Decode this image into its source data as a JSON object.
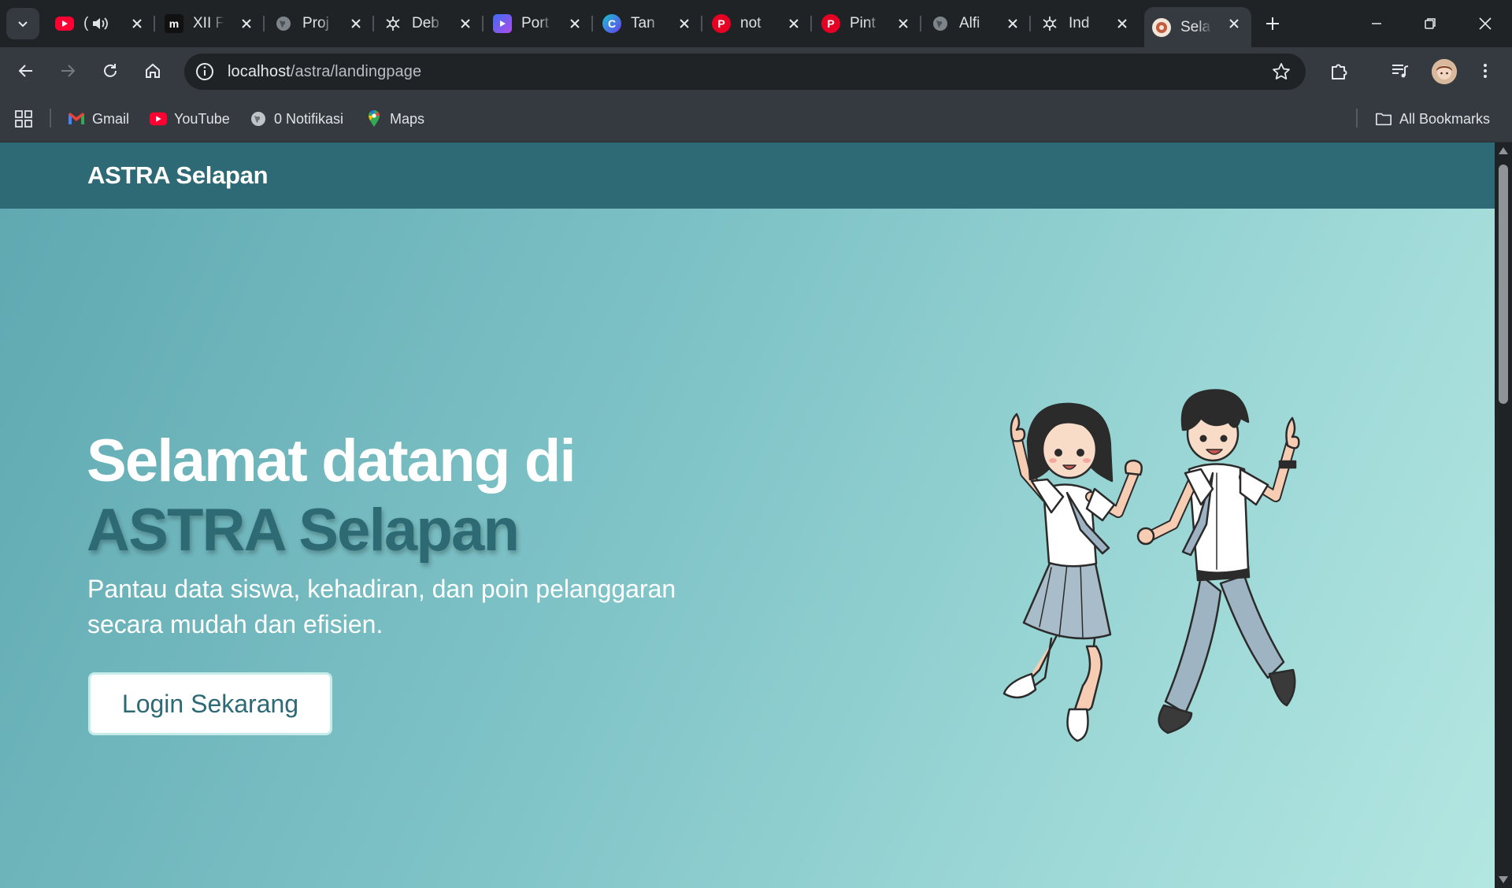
{
  "browser": {
    "tabs": [
      {
        "title": "(",
        "favicon": "youtube-icon",
        "color": "#ff0033"
      },
      {
        "title": "XII F",
        "favicon": "medium-m-icon",
        "color": "#111111"
      },
      {
        "title": "Proj",
        "favicon": "globe-icon",
        "color": "#555c61"
      },
      {
        "title": "Deb",
        "favicon": "openai-icon",
        "color": "#2a2f33"
      },
      {
        "title": "Port",
        "favicon": "video-icon",
        "color": "#6b4cf6"
      },
      {
        "title": "Tan",
        "favicon": "canva-icon",
        "color": "#1f8ce8"
      },
      {
        "title": "not",
        "favicon": "pinterest-icon",
        "color": "#e60023"
      },
      {
        "title": "Pint",
        "favicon": "pinterest-icon",
        "color": "#e60023"
      },
      {
        "title": "Alfi",
        "favicon": "globe-icon",
        "color": "#555c61"
      },
      {
        "title": "Ind",
        "favicon": "openai-icon",
        "color": "#2a2f33"
      },
      {
        "title": "Sela",
        "favicon": "school-icon",
        "color": "#c35b3d",
        "active": true
      }
    ],
    "address": {
      "host": "localhost",
      "path": "/astra/landingpage"
    },
    "bookmarks": [
      {
        "label": "Gmail",
        "icon": "gmail-icon"
      },
      {
        "label": "YouTube",
        "icon": "youtube-icon"
      },
      {
        "label": "0 Notifikasi",
        "icon": "globe-icon"
      },
      {
        "label": "Maps",
        "icon": "maps-icon"
      }
    ],
    "all_bookmarks_label": "All Bookmarks"
  },
  "page": {
    "brand": "ASTRA Selapan",
    "hero": {
      "title_line1": "Selamat datang di",
      "title_line2": "ASTRA Selapan",
      "subtitle": "Pantau data siswa, kehadiran, dan poin pelanggaran secara mudah dan efisien.",
      "cta_label": "Login Sekarang"
    }
  },
  "colors": {
    "navbar": "#2e6a76",
    "accent": "#2d6a73",
    "hero_gradient_start": "#5fa8b1",
    "hero_gradient_end": "#b3e6e1"
  }
}
